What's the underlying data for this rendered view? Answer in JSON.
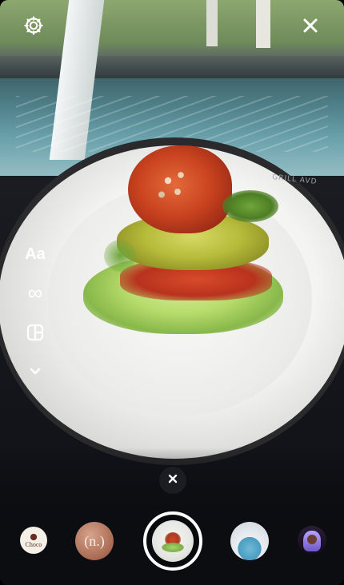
{
  "topbar": {
    "settings_icon": "gear-icon",
    "close_icon": "close-icon"
  },
  "background": {
    "plate_text": "GRILL AVD"
  },
  "side_tools": {
    "text_tool_label": "Aa",
    "boomerang_icon": "infinity-icon",
    "layout_icon": "layout-icon",
    "more_icon": "chevron-down-icon"
  },
  "effects_tray": {
    "dismiss_icon": "close-icon",
    "items": [
      {
        "name": "Choco",
        "icon": "choco-logo"
      },
      {
        "name": "(n.)",
        "icon": "ni-thumbnail"
      },
      {
        "name": "",
        "icon": "capture-preview"
      },
      {
        "name": "",
        "icon": "pool-thumbnail"
      },
      {
        "name": "",
        "icon": "person-thumbnail"
      }
    ]
  }
}
